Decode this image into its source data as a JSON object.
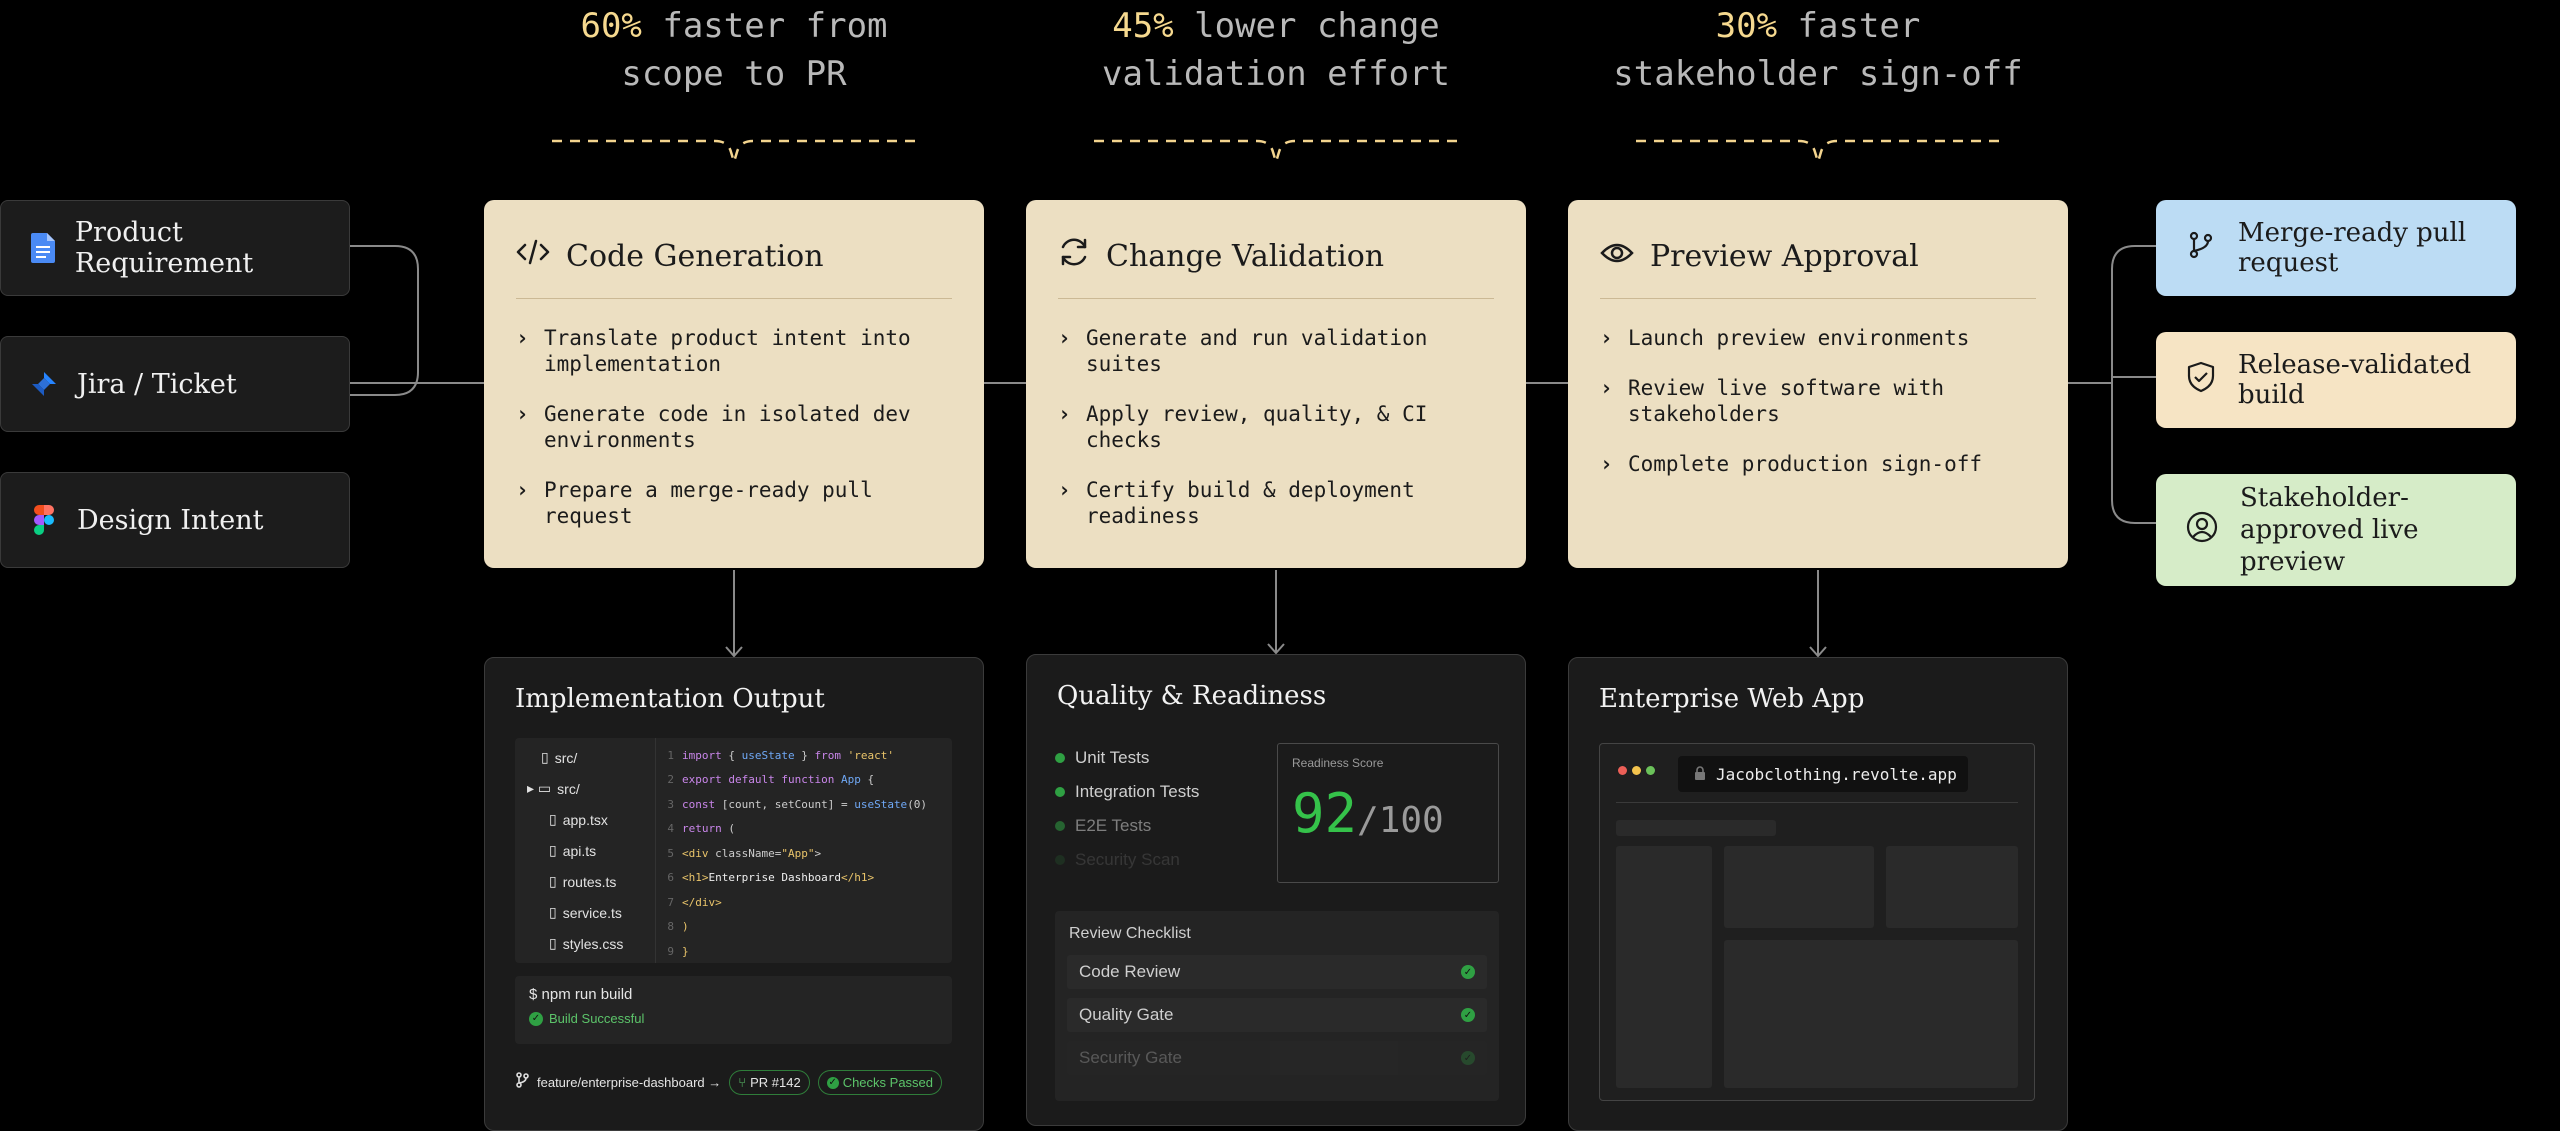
{
  "metrics": [
    {
      "pct": "60%",
      "line1_rest": " faster from",
      "line2": "scope to PR"
    },
    {
      "pct": "45%",
      "line1_rest": " lower change",
      "line2": "validation effort"
    },
    {
      "pct": "30%",
      "line1_rest": " faster",
      "line2": "stakeholder sign-off"
    }
  ],
  "inputs": [
    {
      "label": "Product Requirement",
      "icon": "google-doc-icon"
    },
    {
      "label": "Jira / Ticket",
      "icon": "jira-icon"
    },
    {
      "label": "Design Intent",
      "icon": "figma-icon"
    }
  ],
  "stages": [
    {
      "title": "Code Generation",
      "icon": "code-icon",
      "bullets": [
        "Translate product intent into implementation",
        "Generate code in isolated dev environments",
        "Prepare a merge-ready pull request"
      ]
    },
    {
      "title": "Change Validation",
      "icon": "refresh-icon",
      "bullets": [
        "Generate and run validation suites",
        "Apply review, quality, & CI checks",
        "Certify build & deployment readiness"
      ]
    },
    {
      "title": "Preview Approval",
      "icon": "eye-icon",
      "bullets": [
        "Launch preview environments",
        "Review live software with stakeholders",
        "Complete production sign-off"
      ]
    }
  ],
  "outputs": [
    {
      "label": "Merge-ready pull request",
      "icon": "git-branch-icon",
      "color": "#bcdcf4"
    },
    {
      "label": "Release-validated build",
      "icon": "shield-check-icon",
      "color": "#f6e4c4"
    },
    {
      "label": "Stakeholder-approved live preview",
      "icon": "user-circle-icon",
      "color": "#d6ecc8"
    }
  ],
  "implementation": {
    "title": "Implementation Output",
    "tree": [
      "src/",
      "src/",
      "app.tsx",
      "api.ts",
      "routes.ts",
      "service.ts",
      "styles.css"
    ],
    "code": {
      "n": [
        "1",
        "2",
        "3",
        "4",
        "5",
        "6",
        "7",
        "8",
        "9"
      ],
      "l1": [
        "import",
        " { ",
        "useState",
        " } ",
        "from",
        " 'react'"
      ],
      "l2": [
        "export default function",
        " ",
        "App",
        " {"
      ],
      "l3": [
        "const",
        " [count, setCount] = ",
        "useState",
        "(0)"
      ],
      "l4": [
        "return",
        " ("
      ],
      "l5": [
        "<div",
        " className=",
        "\"App\"",
        ">"
      ],
      "l6": [
        "<h1>",
        "Enterprise Dashboard",
        "</h1>"
      ],
      "l7": [
        "</div>"
      ],
      "l8": [
        ")"
      ],
      "l9": [
        "}"
      ]
    },
    "terminal_cmd": "$ npm run build",
    "terminal_status": "Build Successful",
    "branch": "feature/enterprise-dashboard →",
    "pr": "PR #142",
    "checks": "Checks Passed"
  },
  "quality": {
    "title": "Quality & Readiness",
    "tests": [
      "Unit Tests",
      "Integration Tests",
      "E2E Tests",
      "Security Scan"
    ],
    "score_label": "Readiness Score",
    "score": "92",
    "score_max": "/100",
    "checklist_title": "Review Checklist",
    "checklist": [
      "Code Review",
      "Quality Gate",
      "Security Gate"
    ]
  },
  "webapp": {
    "title": "Enterprise Web App",
    "url": "Jacobclothing.revolte.app"
  }
}
